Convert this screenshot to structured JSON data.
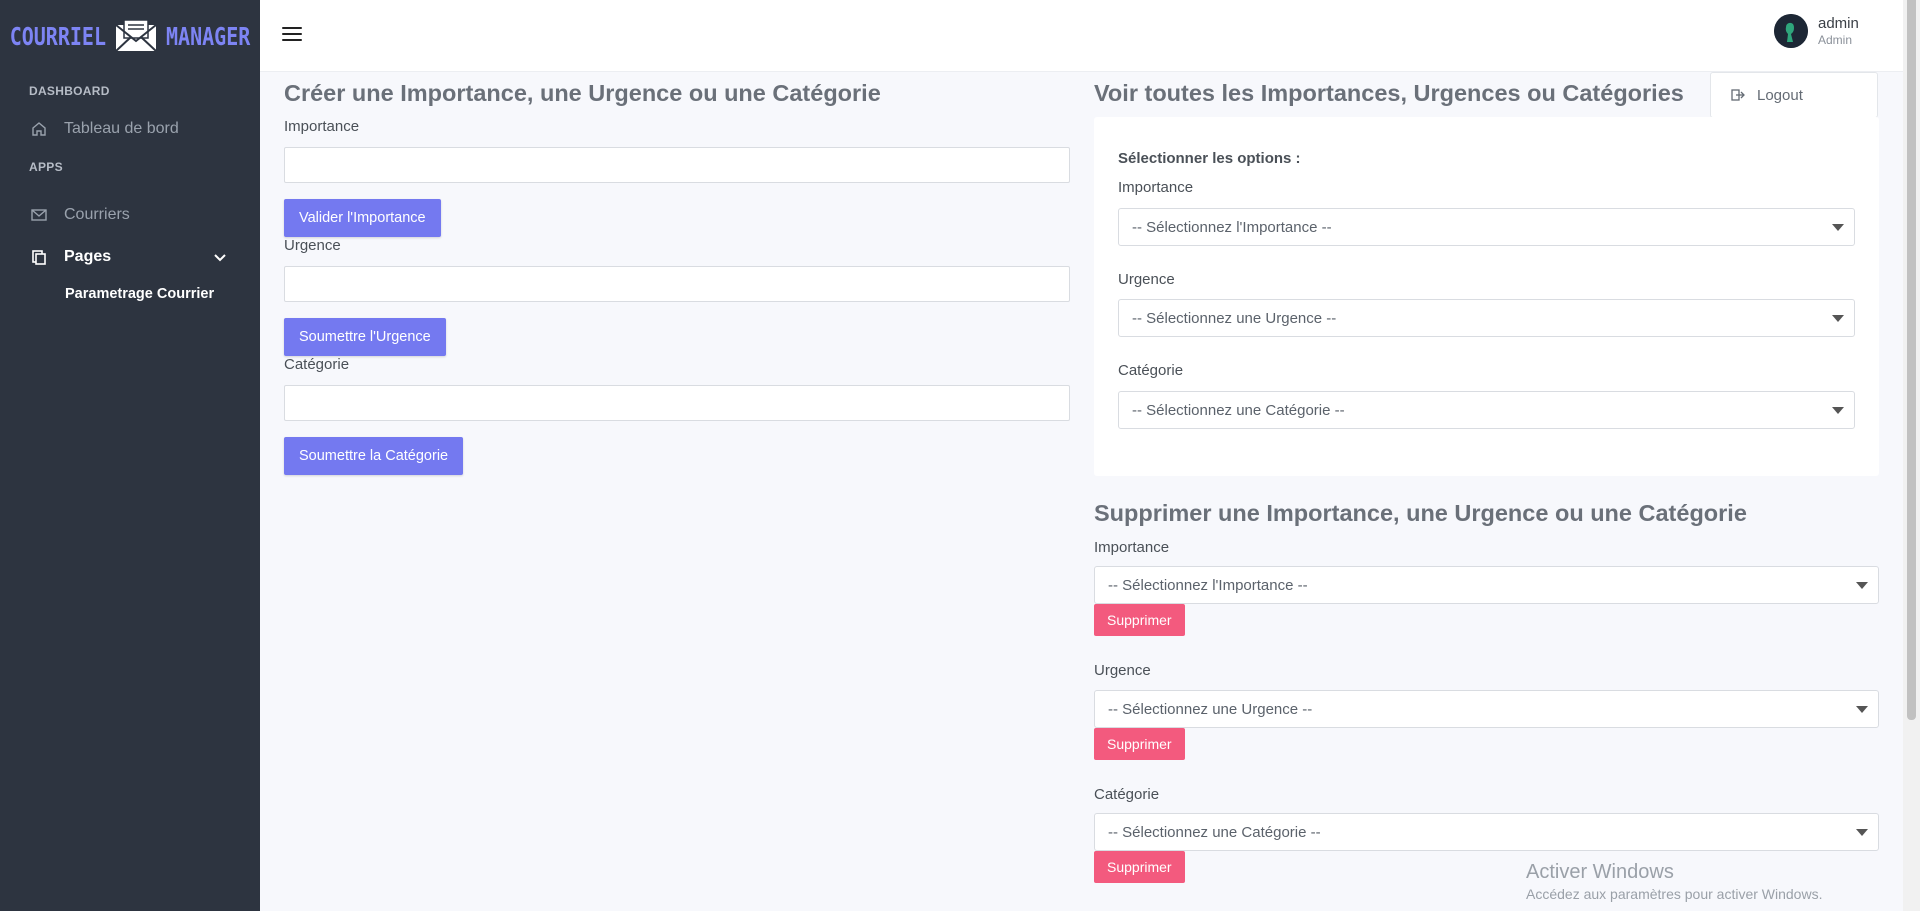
{
  "brand": {
    "left_word": "COURRIEL",
    "right_word": "MANAGER"
  },
  "sidebar": {
    "section_dashboard": "DASHBOARD",
    "dashboard_item": "Tableau de bord",
    "section_apps": "APPS",
    "courriers_item": "Courriers",
    "pages_item": "Pages",
    "sub_item": "Parametrage Courrier"
  },
  "user": {
    "name": "admin",
    "role": "Admin",
    "logout": "Logout"
  },
  "create": {
    "title": "Créer une Importance, une Urgence ou une Catégorie",
    "importance_label": "Importance",
    "importance_value": "",
    "importance_button": "Valider l'Importance",
    "urgence_label": "Urgence",
    "urgence_value": "",
    "urgence_button": "Soumettre l'Urgence",
    "categorie_label": "Catégorie",
    "categorie_value": "",
    "categorie_button": "Soumettre la Catégorie"
  },
  "view": {
    "title": "Voir toutes les Importances, Urgences ou Catégories",
    "options_label": "Sélectionner les options :",
    "importance_label": "Importance",
    "importance_select": "-- Sélectionnez l'Importance --",
    "urgence_label": "Urgence",
    "urgence_select": "-- Sélectionnez une Urgence --",
    "categorie_label": "Catégorie",
    "categorie_select": "-- Sélectionnez une Catégorie --"
  },
  "delete": {
    "title": "Supprimer une Importance, une Urgence ou une Catégorie",
    "importance_label": "Importance",
    "importance_select": "-- Sélectionnez l'Importance --",
    "urgence_label": "Urgence",
    "urgence_select": "-- Sélectionnez une Urgence --",
    "categorie_label": "Catégorie",
    "categorie_select": "-- Sélectionnez une Catégorie --",
    "button_label": "Supprimer"
  },
  "watermark": {
    "line1": "Activer Windows",
    "line2": "Accédez aux paramètres pour activer Windows."
  },
  "colors": {
    "sidebar": "#2d3440",
    "primary": "#7479f0",
    "danger": "#f35a7e",
    "brand": "#7d84f4"
  }
}
